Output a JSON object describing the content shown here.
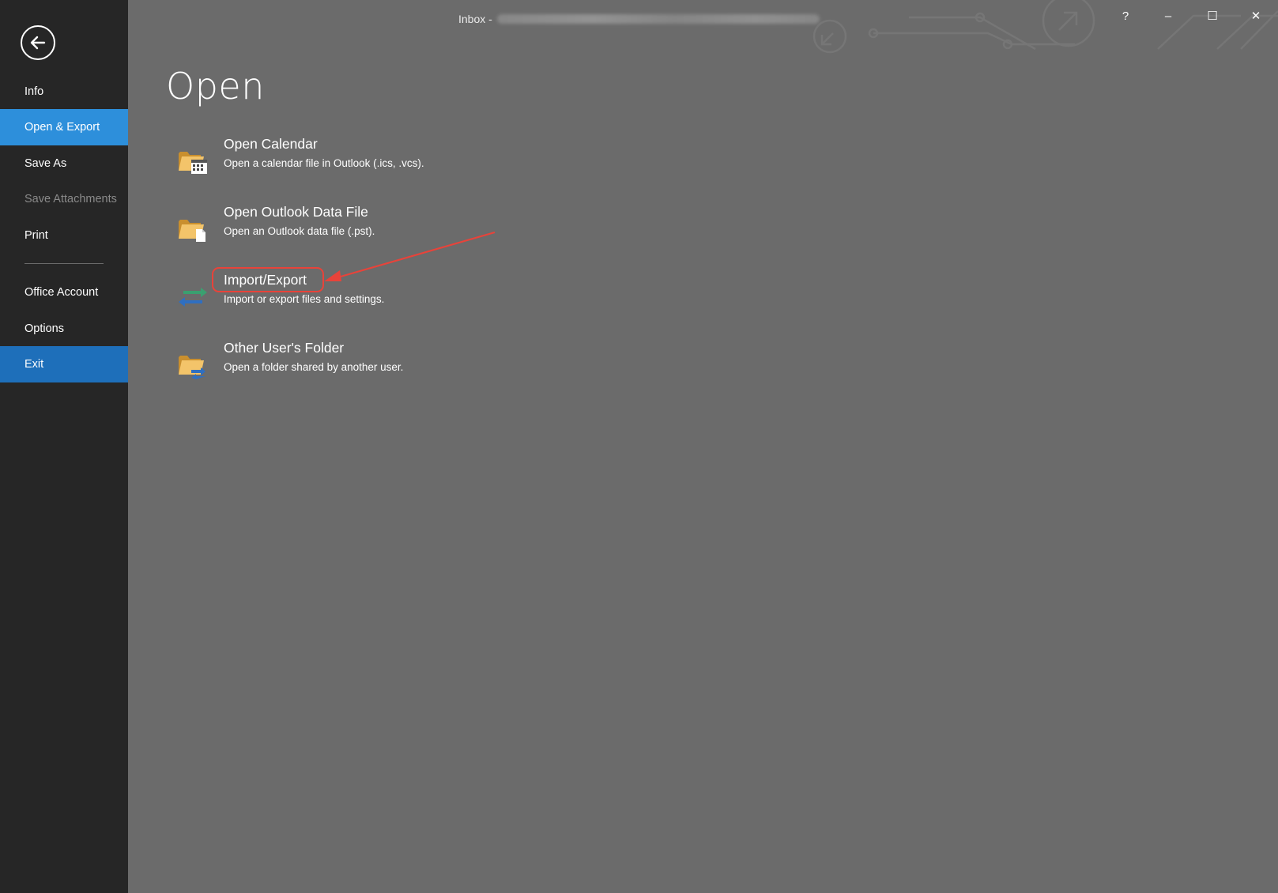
{
  "window": {
    "title_prefix": "Inbox -",
    "controls": {
      "help": "?",
      "minimize": "–",
      "maximize": "☐",
      "close": "✕"
    }
  },
  "sidebar": {
    "back_icon": "back-arrow-icon",
    "items": [
      {
        "label": "Info"
      },
      {
        "label": "Open & Export"
      },
      {
        "label": "Save As"
      },
      {
        "label": "Save Attachments"
      },
      {
        "label": "Print"
      },
      {
        "label": "Office Account"
      },
      {
        "label": "Options"
      },
      {
        "label": "Exit"
      }
    ]
  },
  "main": {
    "title": "Open",
    "options": [
      {
        "title": "Open Calendar",
        "desc": "Open a calendar file in Outlook (.ics, .vcs).",
        "icon": "folder-calendar-icon"
      },
      {
        "title": "Open Outlook Data File",
        "desc": "Open an Outlook data file (.pst).",
        "icon": "folder-file-icon"
      },
      {
        "title": "Import/Export",
        "desc": "Import or export files and settings.",
        "icon": "import-export-icon"
      },
      {
        "title": "Other User's Folder",
        "desc": "Open a folder shared by another user.",
        "icon": "shared-folder-icon"
      }
    ]
  },
  "annotation": {
    "color": "#e8433a"
  },
  "colors": {
    "active": "#2d8fdb",
    "exit": "#1e6fba",
    "sidebar": "#262626",
    "main": "#6b6b6b"
  }
}
